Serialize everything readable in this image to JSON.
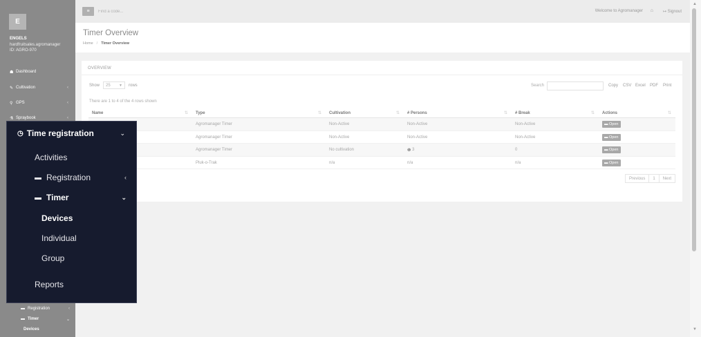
{
  "sidebar": {
    "logo_letter": "E",
    "company": "ENGELS",
    "domain": "hardfruitsales.agromanager",
    "id": "ID: AGRO-970",
    "items": [
      {
        "icon": "☗",
        "label": "Dashboard"
      },
      {
        "icon": "✎",
        "label": "Cultivation"
      },
      {
        "icon": "⚲",
        "label": "GPS"
      },
      {
        "icon": "⚗",
        "label": "Spraybook"
      }
    ],
    "sub_items": [
      {
        "icon": "▬",
        "label": "Registration"
      },
      {
        "icon": "▬",
        "label": "Timer"
      },
      {
        "label": "Devices"
      }
    ]
  },
  "topbar": {
    "menu_icon": "≡",
    "search_placeholder": "Find a code...",
    "welcome": "Welcome to Agromanager",
    "signout": "Signout"
  },
  "page": {
    "title": "Timer Overview",
    "breadcrumb_home": "Home",
    "breadcrumb_sep": "/",
    "breadcrumb_current": "Timer Overview"
  },
  "overview": {
    "title": "OVERVIEW",
    "show_label": "Show",
    "rows_value": "25",
    "rows_label": "rows",
    "search_label": "Search",
    "export_buttons": [
      "Copy",
      "CSV",
      "Excel",
      "PDF",
      "Print"
    ],
    "info": "There are 1 to 4 of the 4 rows shown",
    "columns": [
      "Name",
      "Type",
      "Cultivation",
      "# Persons",
      "# Break",
      "Actions"
    ],
    "rows": [
      {
        "name": "",
        "type": "Agromanager Timer",
        "cultivation": "Non-Active",
        "persons": "Non-Active",
        "break": "Non-Active",
        "action": "Open"
      },
      {
        "name": "",
        "type": "Agromanager Timer",
        "cultivation": "Non-Active",
        "persons": "Non-Active",
        "break": "Non-Active",
        "action": "Open"
      },
      {
        "name": "",
        "type": "Agromanager Timer",
        "cultivation": "No cultivation",
        "persons": "3",
        "break": "0",
        "action": "Open"
      },
      {
        "name": "",
        "type": "Pluk-o-Trak",
        "cultivation": "n/a",
        "persons": "n/a",
        "break": "n/a",
        "action": "Open"
      }
    ],
    "pager": [
      "Previous",
      "1",
      "Next"
    ]
  },
  "popup": {
    "header": "Time registration",
    "items": {
      "activities": "Activities",
      "registration": "Registration",
      "timer": "Timer",
      "devices": "Devices",
      "individual": "Individual",
      "group": "Group",
      "reports": "Reports"
    }
  }
}
